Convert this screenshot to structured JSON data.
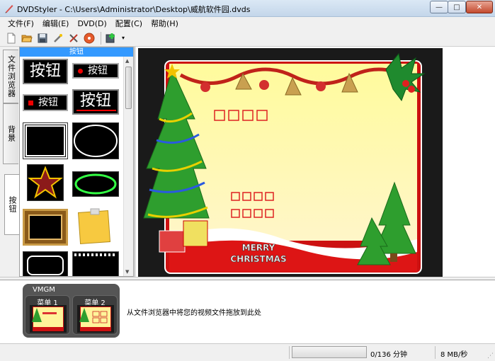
{
  "window": {
    "title": "DVDStyler - C:\\Users\\Administrator\\Desktop\\威航软件园.dvds",
    "min_glyph": "—",
    "max_glyph": "□",
    "close_glyph": "✕"
  },
  "menubar": {
    "items": [
      "文件(F)",
      "编辑(E)",
      "DVD(D)",
      "配置(C)",
      "帮助(H)"
    ]
  },
  "toolbar": {
    "icons": [
      "new-file-icon",
      "open-folder-icon",
      "save-icon",
      "magic-wand-icon",
      "settings-tools-icon",
      "burn-disc-icon",
      "add-file-icon"
    ],
    "dropdown_glyph": "▾"
  },
  "side_tabs": {
    "file_browser": "文件浏览器",
    "background": "背景",
    "buttons": "按钮"
  },
  "buttons_panel": {
    "header": "按钮",
    "button_text": "按钮",
    "scroll_up": "▲",
    "scroll_down": "▼"
  },
  "menu_preview": {
    "caption_line1": "MERRY",
    "caption_line2": "CHRISTMAS",
    "colors": {
      "yellow": "#fff176",
      "red": "#e53935",
      "tree": "#2e9e2e",
      "frame": "#cc1111"
    }
  },
  "titles_panel": {
    "vmgm_label": "VMGM",
    "menus": [
      {
        "label": "菜单 1"
      },
      {
        "label": "菜单 2"
      }
    ],
    "hint": "从文件浏览器中将您的视频文件拖放到此处"
  },
  "statusbar": {
    "progress_fraction": 0.0,
    "duration": "0/136 分钟",
    "rate": "8 MB/秒",
    "grip": "⋰"
  }
}
